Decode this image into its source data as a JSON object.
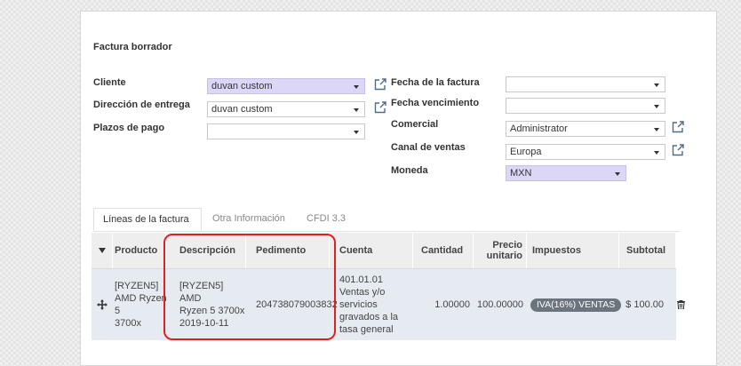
{
  "form": {
    "title": "Factura borrador",
    "cliente_label": "Cliente",
    "cliente_value": "duvan custom",
    "direccion_label": "Dirección de entrega",
    "direccion_value": "duvan custom",
    "plazos_label": "Plazos de pago",
    "plazos_value": "",
    "fecha_factura_label": "Fecha de la factura",
    "fecha_factura_value": "",
    "fecha_venc_label": "Fecha vencimiento",
    "fecha_venc_value": "",
    "comercial_label": "Comercial",
    "comercial_value": "Administrator",
    "canal_label": "Canal de ventas",
    "canal_value": "Europa",
    "moneda_label": "Moneda",
    "moneda_value": "MXN"
  },
  "tabs": [
    {
      "label": "Líneas de la factura"
    },
    {
      "label": "Otra Información"
    },
    {
      "label": "CFDI 3.3"
    }
  ],
  "table": {
    "headers": {
      "producto": "Producto",
      "descripcion": "Descripción",
      "pedimento": "Pedimento",
      "cuenta": "Cuenta",
      "cantidad": "Cantidad",
      "precio_1": "Precio",
      "precio_2": "unitario",
      "impuestos": "Impuestos",
      "subtotal": "Subtotal"
    },
    "rows": [
      {
        "producto_1": "[RYZEN5]",
        "producto_2": "AMD Ryzen 5",
        "producto_3": "3700x",
        "descripcion_1": "[RYZEN5] AMD",
        "descripcion_2": "Ryzen 5 3700x",
        "descripcion_3": "2019-10-11",
        "pedimento": "204738079003832",
        "cuenta_1": "401.01.01",
        "cuenta_2": "Ventas y/o",
        "cuenta_3": "servicios",
        "cuenta_4": "gravados a la",
        "cuenta_5": "tasa general",
        "cantidad": "1.00000",
        "precio": "100.00000",
        "impuesto": "IVA(16%) VENTAS",
        "subtotal": "$ 100.00"
      }
    ]
  },
  "colors": {
    "highlight": "#e02020",
    "lavender_field": "#dcd7f7",
    "badge": "#6c757d"
  }
}
